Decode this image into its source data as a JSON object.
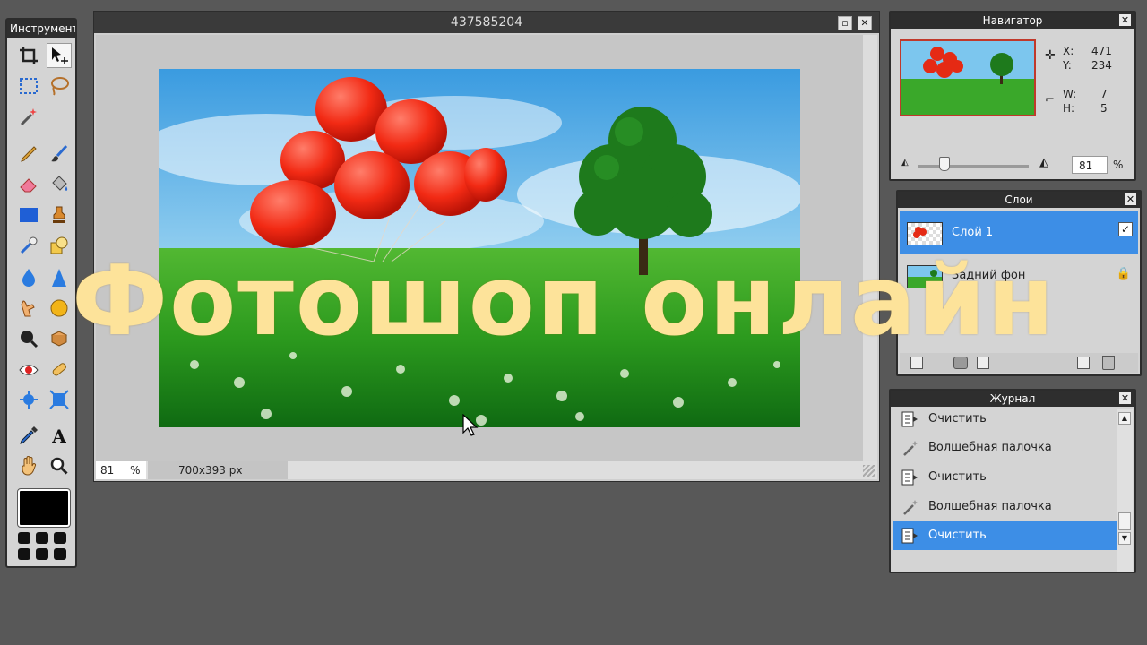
{
  "tools_panel": {
    "title": "Инструмент"
  },
  "document": {
    "title": "437585204",
    "zoom": "81",
    "zoom_unit": "%",
    "dimensions": "700x393 px"
  },
  "navigator": {
    "title": "Навигатор",
    "x_label": "X:",
    "x_value": "471",
    "y_label": "Y:",
    "y_value": "234",
    "w_label": "W:",
    "w_value": "7",
    "h_label": "H:",
    "h_value": "5",
    "zoom_value": "81",
    "zoom_unit": "%",
    "zoom_level": 0.2
  },
  "layers": {
    "title": "Слои",
    "items": [
      {
        "name": "Слой 1",
        "active": true,
        "visible": true
      },
      {
        "name": "Задний фон",
        "active": false,
        "locked": true
      }
    ]
  },
  "journal": {
    "title": "Журнал",
    "items": [
      {
        "label": "Очистить",
        "icon": "clear-icon"
      },
      {
        "label": "Волшебная палочка",
        "icon": "magic-wand-icon"
      },
      {
        "label": "Очистить",
        "icon": "clear-icon"
      },
      {
        "label": "Волшебная палочка",
        "icon": "magic-wand-icon"
      },
      {
        "label": "Очистить",
        "icon": "clear-icon",
        "active": true
      }
    ]
  },
  "overlay_title": "Фотошоп онлайн",
  "colors": {
    "accent": "#3d8ee6",
    "overlay_text": "#fde39a",
    "foreground": "#000000"
  }
}
